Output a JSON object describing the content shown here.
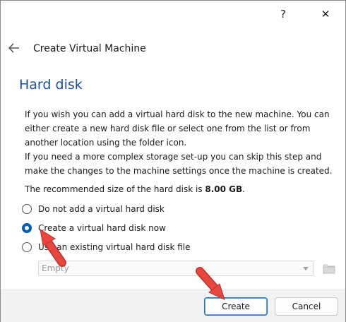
{
  "titlebar": {
    "help_label": "?",
    "close_label": "✕"
  },
  "header": {
    "title": "Create Virtual Machine"
  },
  "section": {
    "title": "Hard disk"
  },
  "paragraphs": {
    "intro": "If you wish you can add a virtual hard disk to the new machine. You can either create a new hard disk file or select one from the list or from another location using the folder icon.",
    "complex": "If you need a more complex storage set-up you can skip this step and make the changes to the machine settings once the machine is created.",
    "recommended_prefix": "The recommended size of the hard disk is ",
    "recommended_size": "8.00 GB",
    "recommended_suffix": "."
  },
  "options": [
    {
      "label": "Do not add a virtual hard disk",
      "checked": false
    },
    {
      "label": "Create a virtual hard disk now",
      "checked": true
    },
    {
      "label": "Use an existing virtual hard disk file",
      "checked": false
    }
  ],
  "existing_disk_combo": {
    "value": "Empty",
    "enabled": false
  },
  "footer": {
    "create_label": "Create",
    "cancel_label": "Cancel"
  },
  "colors": {
    "section_title": "#1f4e9d",
    "radio_checked": "#005fb8",
    "arrow": "#e8473f"
  },
  "icons": {
    "back": "back-arrow-icon",
    "folder": "folder-icon"
  }
}
